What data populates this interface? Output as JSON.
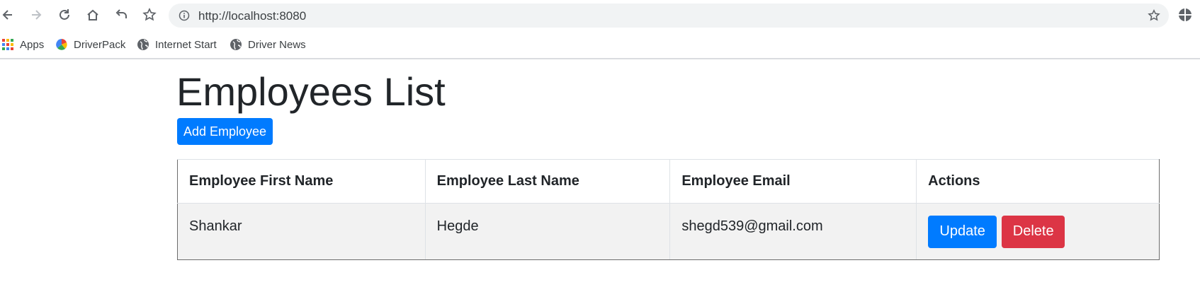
{
  "browser": {
    "url": "http://localhost:8080",
    "bookmarks": [
      {
        "label": "Apps",
        "icon": "apps-grid-icon"
      },
      {
        "label": "DriverPack",
        "icon": "driverpack-icon"
      },
      {
        "label": "Internet Start",
        "icon": "globe-icon"
      },
      {
        "label": "Driver News",
        "icon": "globe-icon"
      }
    ]
  },
  "page": {
    "title": "Employees List",
    "add_button": "Add Employee"
  },
  "table": {
    "headers": [
      "Employee First Name",
      "Employee Last Name",
      "Employee Email",
      "Actions"
    ],
    "rows": [
      {
        "first_name": "Shankar",
        "last_name": "Hegde",
        "email": "shegd539@gmail.com"
      }
    ],
    "update_label": "Update",
    "delete_label": "Delete"
  },
  "colors": {
    "primary": "#007bff",
    "danger": "#dc3545",
    "row_background": "#f2f2f2"
  }
}
